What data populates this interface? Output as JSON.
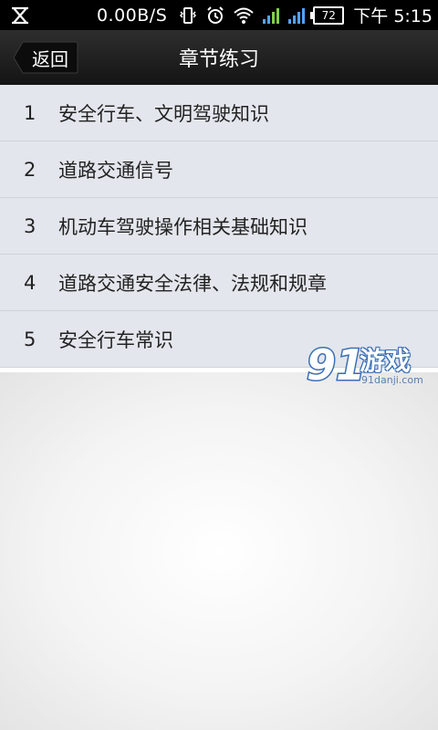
{
  "status_bar": {
    "net_speed": "0.00B/S",
    "battery_level": "72",
    "time": "下午 5:15",
    "icons": [
      "usb-debug-icon",
      "vibrate-icon",
      "alarm-icon",
      "wifi-icon",
      "signal-icon",
      "signal-icon-2",
      "battery-icon"
    ]
  },
  "header": {
    "back_label": "返回",
    "title": "章节练习"
  },
  "chapters": [
    {
      "num": "1",
      "label": "安全行车、文明驾驶知识"
    },
    {
      "num": "2",
      "label": "道路交通信号"
    },
    {
      "num": "3",
      "label": "机动车驾驶操作相关基础知识"
    },
    {
      "num": "4",
      "label": "道路交通安全法律、法规和规章"
    },
    {
      "num": "5",
      "label": "安全行车常识"
    }
  ],
  "watermark": {
    "logo_number": "91",
    "logo_text": "游戏",
    "site": "91danji.com"
  },
  "colors": {
    "list_bg": "#e3e6ec",
    "title_bar": "#1f1f1f",
    "status_bar": "#000000"
  }
}
